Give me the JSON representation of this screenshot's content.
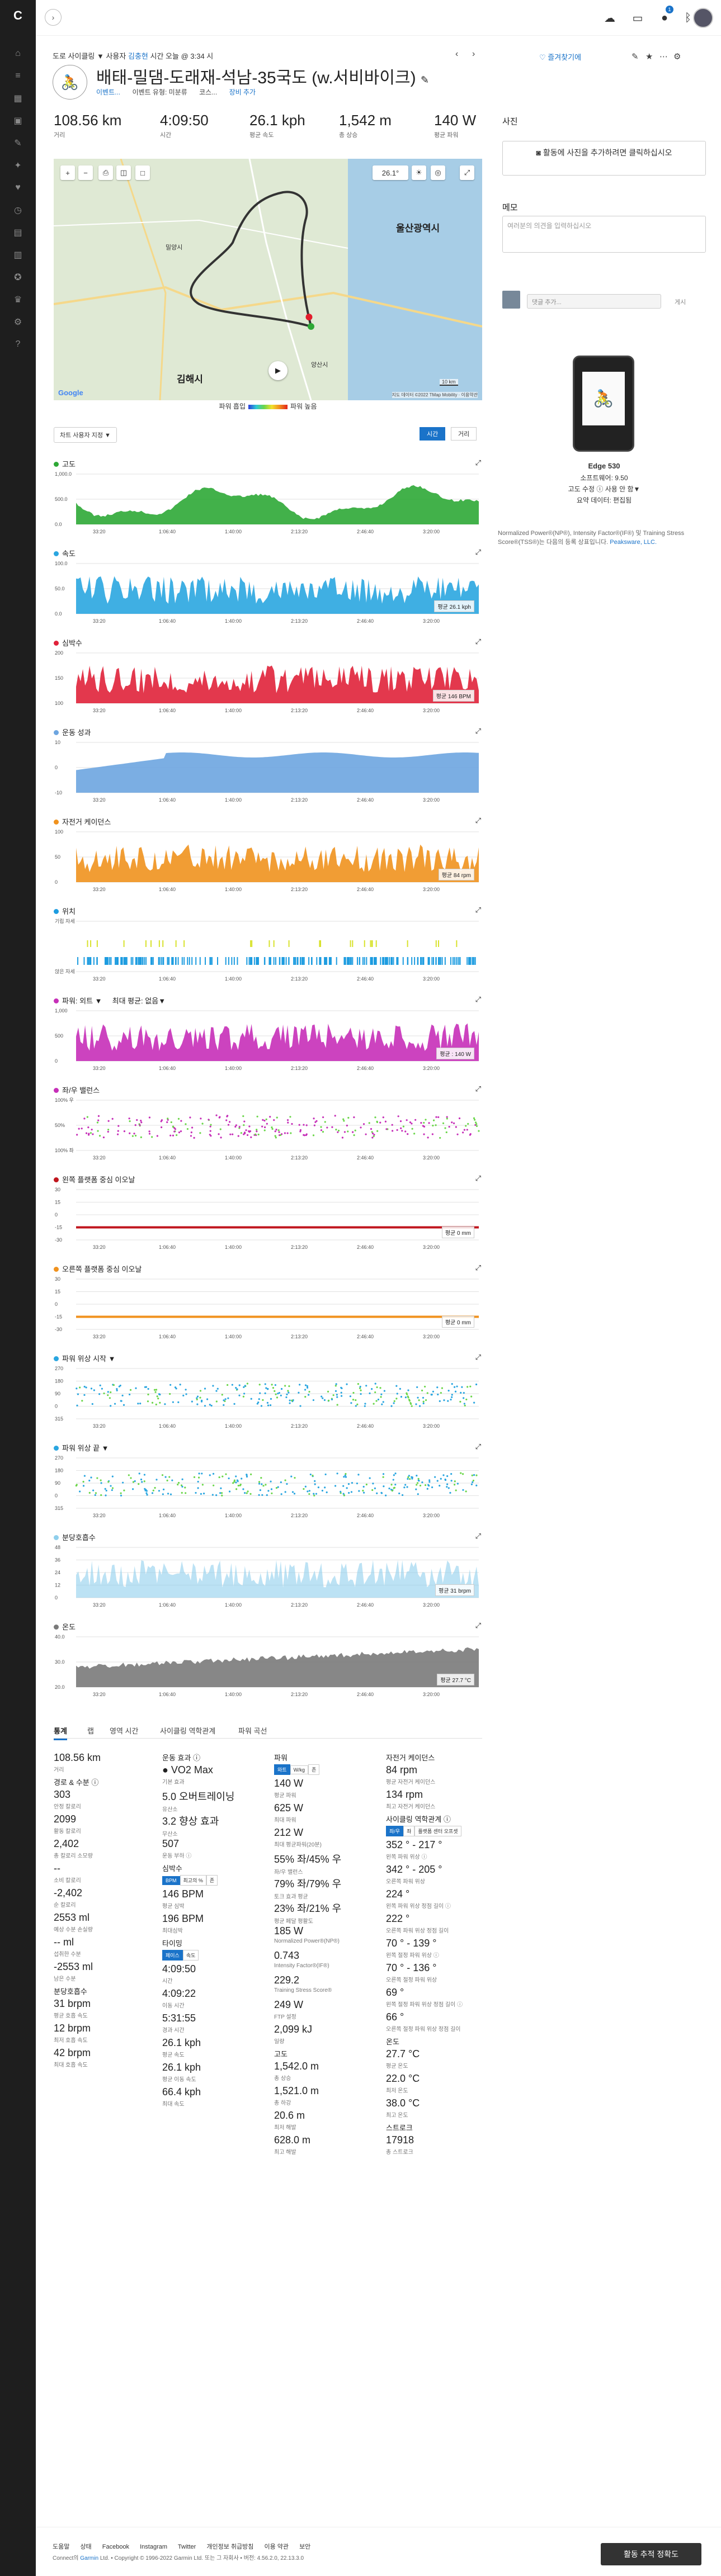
{
  "topbar": {
    "badge_count": "1",
    "icons": [
      "cloud-icon",
      "inbox-icon",
      "notification-icon",
      "bluetooth-icon"
    ]
  },
  "header": {
    "breadcrumb": [
      "도로 사이클링",
      "사용자",
      "김충현",
      "시간 오늘 @ 3:34 시"
    ],
    "title": "배태-밀댐-도래재-석남-35국도 (w.서비바이크)",
    "subinfo": [
      "이벤트...",
      "이벤트 유형: 미분류",
      "코스...",
      "장비 추가"
    ],
    "follow_label": "즐겨찾기에"
  },
  "summary": [
    {
      "value": "108.56 km",
      "label": "거리"
    },
    {
      "value": "4:09:50",
      "label": "시간"
    },
    {
      "value": "26.1 kph",
      "label": "평균 속도"
    },
    {
      "value": "1,542 m",
      "label": "총 상승"
    },
    {
      "value": "140 W",
      "label": "평균 파워"
    }
  ],
  "map": {
    "temp": "26.1°",
    "labels": [
      "울산광역시",
      "김해시",
      "양산시",
      "밀양시"
    ],
    "scale": "10 km",
    "attribution": "지도 데이터 ©2022 TMap Mobility · 이용약관",
    "google": "Google",
    "legend_left": "파워 흡입",
    "legend_right": "파워 높음"
  },
  "chart_controls": {
    "dropdown": "차트 사용자 지정 ▼",
    "time": "시간",
    "distance": "거리"
  },
  "charts": [
    {
      "title": "고도",
      "color": "#2ea836",
      "yticks": [
        "1,000.0",
        "500.0",
        "0.0"
      ],
      "avg": ""
    },
    {
      "title": "속도",
      "color": "#2aa6e0",
      "yticks": [
        "100.0",
        "50.0",
        "0.0"
      ],
      "avg": "평균 26.1 kph"
    },
    {
      "title": "심박수",
      "color": "#e0223a",
      "yticks": [
        "200",
        "150",
        "100"
      ],
      "avg": "평균 146 BPM"
    },
    {
      "title": "운동 성과",
      "color": "#6da5e0",
      "yticks": [
        "10",
        "0",
        "-10"
      ],
      "avg": ""
    },
    {
      "title": "자전거 케이던스",
      "color": "#f0921e",
      "yticks": [
        "100",
        "50",
        "0"
      ],
      "avg": "평균 84 rpm"
    },
    {
      "title": "위치",
      "color": "#1d9ce0",
      "yticks": [
        "기립 자세",
        "앉은 자세"
      ],
      "avg": ""
    },
    {
      "title": "파워: 외트 ▼",
      "subtitle": "최대 평균: 없음▼",
      "color": "#c62fb8",
      "yticks": [
        "1,000",
        "500",
        "0"
      ],
      "avg": "평균 : 140 W"
    },
    {
      "title": "좌/우 밸런스",
      "color": "#c62fb8",
      "yticks": [
        "100% 우",
        "50%",
        "100% 좌"
      ],
      "avg": ""
    },
    {
      "title": "왼쪽 플랫폼 중심 이오날",
      "color": "#c0161e",
      "yticks": [
        "30",
        "15",
        "0",
        "-15",
        "-30"
      ],
      "avg": "평균 0 mm"
    },
    {
      "title": "오른쪽 플랫폼 중심 이오날",
      "color": "#f0921e",
      "yticks": [
        "30",
        "15",
        "0",
        "-15",
        "-30"
      ],
      "avg": "평균 0 mm"
    },
    {
      "title": "파워 위상 시작 ▼",
      "color": "#2aa6e0",
      "yticks": [
        "270",
        "180",
        "90",
        "0",
        "315"
      ],
      "avg": ""
    },
    {
      "title": "파워 위상 끝 ▼",
      "color": "#2aa6e0",
      "yticks": [
        "270",
        "180",
        "90",
        "0",
        "315"
      ],
      "avg": ""
    },
    {
      "title": "분당호흡수",
      "color": "#8fcfec",
      "yticks": [
        "48",
        "36",
        "24",
        "12",
        "0"
      ],
      "avg": "평균 31 brpm"
    },
    {
      "title": "온도",
      "color": "#7a7a7a",
      "yticks": [
        "40.0",
        "30.0",
        "20.0"
      ],
      "avg": "평균 27.7 °C"
    }
  ],
  "xticks": [
    "33:20",
    "1:06:40",
    "1:40:00",
    "2:13:20",
    "2:46:40",
    "3:20:00",
    "3:53:20"
  ],
  "tabs": [
    "통계",
    "랩",
    "영역 시간",
    "사이클링 역학관계",
    "파워 곡선"
  ],
  "stats": {
    "col1": [
      {
        "type": "item",
        "v": "108.56 km",
        "l": "거리"
      },
      {
        "type": "section",
        "t": "경로 & 수분 ⓘ"
      },
      {
        "type": "item",
        "v": "303",
        "l": "안정 칼로리"
      },
      {
        "type": "item",
        "v": "2099",
        "l": "활동 칼로리"
      },
      {
        "type": "item",
        "v": "2,402",
        "l": "총 칼로리 소모량"
      },
      {
        "type": "item",
        "v": "--",
        "l": "소비 칼로리"
      },
      {
        "type": "item",
        "v": "-2,402",
        "l": "순 칼로리"
      },
      {
        "type": "item",
        "v": "2553 ml",
        "l": "예상 수분 손실량"
      },
      {
        "type": "item",
        "v": "-- ml",
        "l": "섭취한 수분"
      },
      {
        "type": "item",
        "v": "-2553 ml",
        "l": "남은 수분"
      },
      {
        "type": "section",
        "t": "분당호흡수"
      },
      {
        "type": "item",
        "v": "31 brpm",
        "l": "평균 호흡 속도"
      },
      {
        "type": "item",
        "v": "12 brpm",
        "l": "최저 호흡 속도"
      },
      {
        "type": "item",
        "v": "42 brpm",
        "l": "최대 호흡 속도"
      }
    ],
    "col2": [
      {
        "type": "section",
        "t": "운동 효과 ⓘ"
      },
      {
        "type": "item",
        "v": "● VO2 Max",
        "l": "기본 효과"
      },
      {
        "type": "item",
        "v": "5.0 오버트레이닝",
        "l": "유산소"
      },
      {
        "type": "item",
        "v": "3.2 향상 효과",
        "l": "무산소"
      },
      {
        "type": "item",
        "v": "507",
        "l": "운동 부하 ⓘ"
      },
      {
        "type": "section",
        "t": "심박수"
      },
      {
        "type": "toggle",
        "opts": [
          "BPM",
          "최고의 %",
          "존"
        ]
      },
      {
        "type": "item",
        "v": "146 BPM",
        "l": "평균 심박"
      },
      {
        "type": "item",
        "v": "196 BPM",
        "l": "최대심박"
      },
      {
        "type": "section",
        "t": "타이밍"
      },
      {
        "type": "toggle",
        "opts": [
          "페이스",
          "속도"
        ]
      },
      {
        "type": "item",
        "v": "4:09:50",
        "l": "시간"
      },
      {
        "type": "item",
        "v": "4:09:22",
        "l": "이동 시간"
      },
      {
        "type": "item",
        "v": "5:31:55",
        "l": "경과 시간"
      },
      {
        "type": "item",
        "v": "26.1 kph",
        "l": "평균 속도"
      },
      {
        "type": "item",
        "v": "26.1 kph",
        "l": "평균 이동 속도"
      },
      {
        "type": "item",
        "v": "66.4 kph",
        "l": "최대 속도"
      }
    ],
    "col3": [
      {
        "type": "section",
        "t": "파워"
      },
      {
        "type": "toggle",
        "opts": [
          "와트",
          "W/kg",
          "존"
        ]
      },
      {
        "type": "item",
        "v": "140 W",
        "l": "평균 파워"
      },
      {
        "type": "item",
        "v": "625 W",
        "l": "최대 파워"
      },
      {
        "type": "item",
        "v": "212 W",
        "l": "최대 평균파워(20분)"
      },
      {
        "type": "item",
        "v": "55% 좌/45% 우",
        "l": "좌/우 밸런스"
      },
      {
        "type": "item",
        "v": "79% 좌/79% 우",
        "l": "토크 효과 평균"
      },
      {
        "type": "item",
        "v": "23% 좌/21% 우",
        "l": "평균 페달 평활도"
      },
      {
        "type": "item",
        "v": "185 W",
        "l": "Normalized Power®(NP®)"
      },
      {
        "type": "item",
        "v": "0.743",
        "l": "Intensity Factor®(IF®)"
      },
      {
        "type": "item",
        "v": "229.2",
        "l": "Training Stress Score®"
      },
      {
        "type": "item",
        "v": "249 W",
        "l": "FTP 설정"
      },
      {
        "type": "item",
        "v": "2,099 kJ",
        "l": "일량"
      },
      {
        "type": "section",
        "t": "고도"
      },
      {
        "type": "item",
        "v": "1,542.0 m",
        "l": "총 상승"
      },
      {
        "type": "item",
        "v": "1,521.0 m",
        "l": "총 하강"
      },
      {
        "type": "item",
        "v": "20.6 m",
        "l": "최저 해발"
      },
      {
        "type": "item",
        "v": "628.0 m",
        "l": "최고 해발"
      }
    ],
    "col4": [
      {
        "type": "section",
        "t": "자전거 케이던스"
      },
      {
        "type": "item",
        "v": "84 rpm",
        "l": "평균 자전거 케이던스"
      },
      {
        "type": "item",
        "v": "134 rpm",
        "l": "최고 자전거 케이던스"
      },
      {
        "type": "section",
        "t": "사이클링 역학관계 ⓘ"
      },
      {
        "type": "toggle",
        "opts": [
          "좌/우",
          "좌",
          "플랫폼 센터 오프셋"
        ]
      },
      {
        "type": "item",
        "v": "352 ° - 217 °",
        "l": "왼쪽 파워 위상 ⓘ"
      },
      {
        "type": "item",
        "v": "342 ° - 205 °",
        "l": "오른쪽 파워 위상"
      },
      {
        "type": "item",
        "v": "224 °",
        "l": "왼쪽 파워 위상 정점 길이 ⓘ"
      },
      {
        "type": "item",
        "v": "222 °",
        "l": "오른쪽 파워 위상 정점 길이"
      },
      {
        "type": "item",
        "v": "70 ° - 139 °",
        "l": "왼쪽 절정 파워 위상 ⓘ"
      },
      {
        "type": "item",
        "v": "70 ° - 136 °",
        "l": "오른쪽 절정 파워 위상"
      },
      {
        "type": "item",
        "v": "69 °",
        "l": "왼쪽 절정 파워 위상 정점 길이 ⓘ"
      },
      {
        "type": "item",
        "v": "66 °",
        "l": "오른쪽 절정 파워 위상 정점 길이"
      },
      {
        "type": "section",
        "t": "온도"
      },
      {
        "type": "item",
        "v": "27.7 °C",
        "l": "평균 온도"
      },
      {
        "type": "item",
        "v": "22.0 °C",
        "l": "최저 온도"
      },
      {
        "type": "item",
        "v": "38.0 °C",
        "l": "최고 온도"
      },
      {
        "type": "section",
        "t": "스트로크"
      },
      {
        "type": "item",
        "v": "17918",
        "l": "총 스트로크"
      }
    ]
  },
  "side": {
    "photos_title": "사진",
    "add_photo": "활동에 사진을 추가하려면 클릭하십시오",
    "notes_title": "메모",
    "notes_placeholder": "여러분의 의견을 입력하십시오",
    "comment_placeholder": "댓글 추가...",
    "comment_button": "게시",
    "device_name": "Edge 530",
    "software": "소프트웨어: 9.50",
    "elev_corr": "고도 수정 ⓘ 사용 안 함▼",
    "data_summary": "요약 데이터: 편집됨",
    "power_note": "Normalized Power®(NP®), Intensity Factor®(IF®) 및 Training Stress Score®(TSS®)는 다음의 등록 상표입니다.",
    "power_note_link": "Peaksware, LLC."
  },
  "footer": {
    "links": [
      "도움말",
      "상태",
      "Facebook",
      "Instagram",
      "Twitter",
      "개인정보 취급방침",
      "이용 약관",
      "보안"
    ],
    "copyright": "Connect의",
    "copyright_link": "Garmin",
    "copyright_rest": "Ltd. • Copyright © 1996-2022 Garmin Ltd. 또는 그 자회사 • 버전: 4.56.2.0, 22.13.3.0",
    "button": "활동 추적 정확도"
  }
}
